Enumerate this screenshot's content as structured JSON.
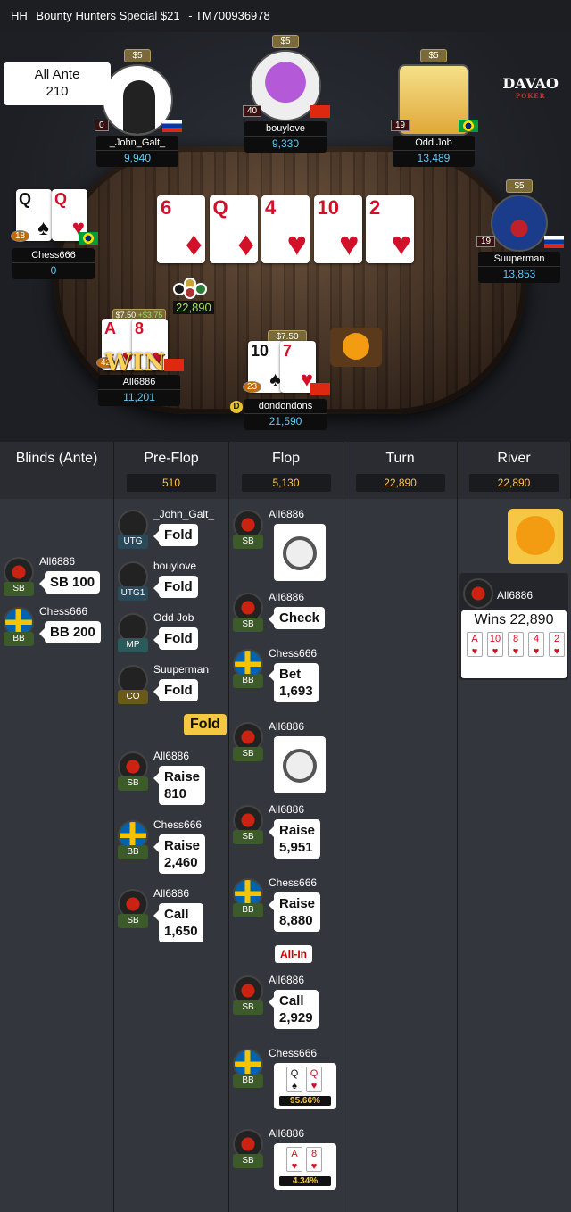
{
  "header": {
    "code": "HH",
    "title": "Bounty Hunters Special $21",
    "id": "- TM700936978"
  },
  "logo": {
    "text": "DAVAO",
    "sub": "POKER"
  },
  "seats": {
    "john": {
      "bet": "$5",
      "level": "0",
      "name": "_John_Galt_",
      "stack": "9,940"
    },
    "bouy": {
      "bet": "$5",
      "level": "40",
      "name": "bouylove",
      "stack": "9,330"
    },
    "odd": {
      "bet": "$5",
      "level": "19",
      "name": "Odd Job",
      "stack": "13,489"
    },
    "chess": {
      "level": "18",
      "name": "Chess666",
      "stack": "0"
    },
    "suup": {
      "bet": "$5",
      "level": "19",
      "name": "Suuperman",
      "stack": "13,853"
    },
    "all": {
      "bet": "$7.50",
      "bonus": "+$3.75",
      "level": "42",
      "name": "All6886",
      "stack": "11,201"
    },
    "dond": {
      "bet": "$7.50",
      "level": "23",
      "name": "dondondons",
      "stack": "21,590"
    }
  },
  "board": [
    {
      "r": "6",
      "s": "♦"
    },
    {
      "r": "Q",
      "s": "♦"
    },
    {
      "r": "4",
      "s": "♥"
    },
    {
      "r": "10",
      "s": "♥"
    },
    {
      "r": "2",
      "s": "♥"
    }
  ],
  "pot": "22,890",
  "win_label": "WIN",
  "dealer": "D",
  "hands": {
    "chess": [
      {
        "r": "Q",
        "s": "♠"
      },
      {
        "r": "Q",
        "s": "♥"
      }
    ],
    "all": [
      {
        "r": "A",
        "s": "♥"
      },
      {
        "r": "8",
        "s": "♥"
      }
    ],
    "dond": [
      {
        "r": "10",
        "s": "♠"
      },
      {
        "r": "7",
        "s": "♥"
      }
    ]
  },
  "history": {
    "columns": [
      {
        "t": "Blinds (Ante)",
        "v": ""
      },
      {
        "t": "Pre-Flop",
        "v": "510"
      },
      {
        "t": "Flop",
        "v": "5,130"
      },
      {
        "t": "Turn",
        "v": "22,890"
      },
      {
        "t": "River",
        "v": "22,890"
      }
    ],
    "ante": {
      "l1": "All Ante",
      "l2": "210"
    },
    "blinds": [
      {
        "who": "All6886",
        "pos": "SB",
        "act": "SB 100"
      },
      {
        "who": "Chess666",
        "pos": "BB",
        "act": "BB 200"
      }
    ],
    "preflop": [
      {
        "who": "_John_Galt_",
        "pos": "UTG",
        "act": "Fold"
      },
      {
        "who": "bouylove",
        "pos": "UTG1",
        "act": "Fold"
      },
      {
        "who": "Odd Job",
        "pos": "MP",
        "act": "Fold"
      },
      {
        "who": "Suuperman",
        "pos": "CO",
        "act": "Fold"
      },
      {
        "who": "All6886",
        "pos": "SB",
        "a1": "Raise",
        "a2": "810"
      },
      {
        "who": "Chess666",
        "pos": "BB",
        "a1": "Raise",
        "a2": "2,460"
      },
      {
        "who": "All6886",
        "pos": "SB",
        "a1": "Call",
        "a2": "1,650"
      }
    ],
    "yourfold": "Fold",
    "flop": [
      {
        "who": "All6886",
        "pos": "SB"
      },
      {
        "who": "All6886",
        "pos": "SB",
        "act": "Check"
      },
      {
        "who": "Chess666",
        "pos": "BB",
        "a1": "Bet",
        "a2": "1,693"
      },
      {
        "who": "All6886",
        "pos": "SB"
      },
      {
        "who": "All6886",
        "pos": "SB",
        "a1": "Raise",
        "a2": "5,951"
      },
      {
        "who": "Chess666",
        "pos": "BB",
        "a1": "Raise",
        "a2": "8,880"
      },
      {
        "who": "All6886",
        "pos": "SB",
        "a1": "Call",
        "a2": "2,929"
      },
      {
        "who": "Chess666",
        "pos": "BB",
        "pct": "95.66%"
      },
      {
        "who": "All6886",
        "pos": "SB",
        "pct": "4.34%"
      }
    ],
    "allin": "All-In",
    "river": {
      "who": "All6886",
      "wins": "Wins 22,890",
      "cards": [
        "A",
        "10",
        "8",
        "4",
        "2"
      ]
    }
  }
}
